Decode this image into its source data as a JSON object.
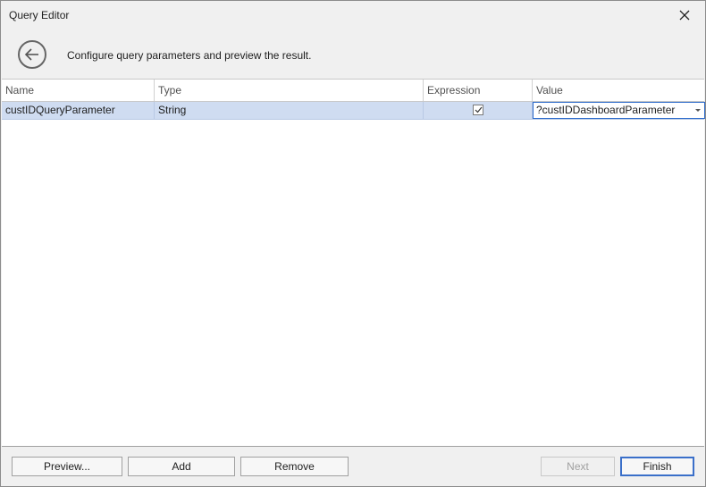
{
  "window": {
    "title": "Query Editor"
  },
  "header": {
    "subtitle": "Configure query parameters and preview the result."
  },
  "grid": {
    "columns": [
      "Name",
      "Type",
      "Expression",
      "Value"
    ],
    "rows": [
      {
        "name": "custIDQueryParameter",
        "type": "String",
        "expression": true,
        "value": "?custIDDashboardParameter"
      }
    ]
  },
  "footer": {
    "preview_label": "Preview...",
    "add_label": "Add",
    "remove_label": "Remove",
    "next_label": "Next",
    "finish_label": "Finish"
  },
  "icons": {
    "close": "close-icon",
    "back": "back-arrow-icon",
    "check": "checkmark-icon",
    "dropdown": "chevron-down-icon"
  },
  "colors": {
    "selected_row": "#cfdcf1",
    "editor_border": "#2b6acb",
    "default_button_border": "#3a6fc9"
  }
}
